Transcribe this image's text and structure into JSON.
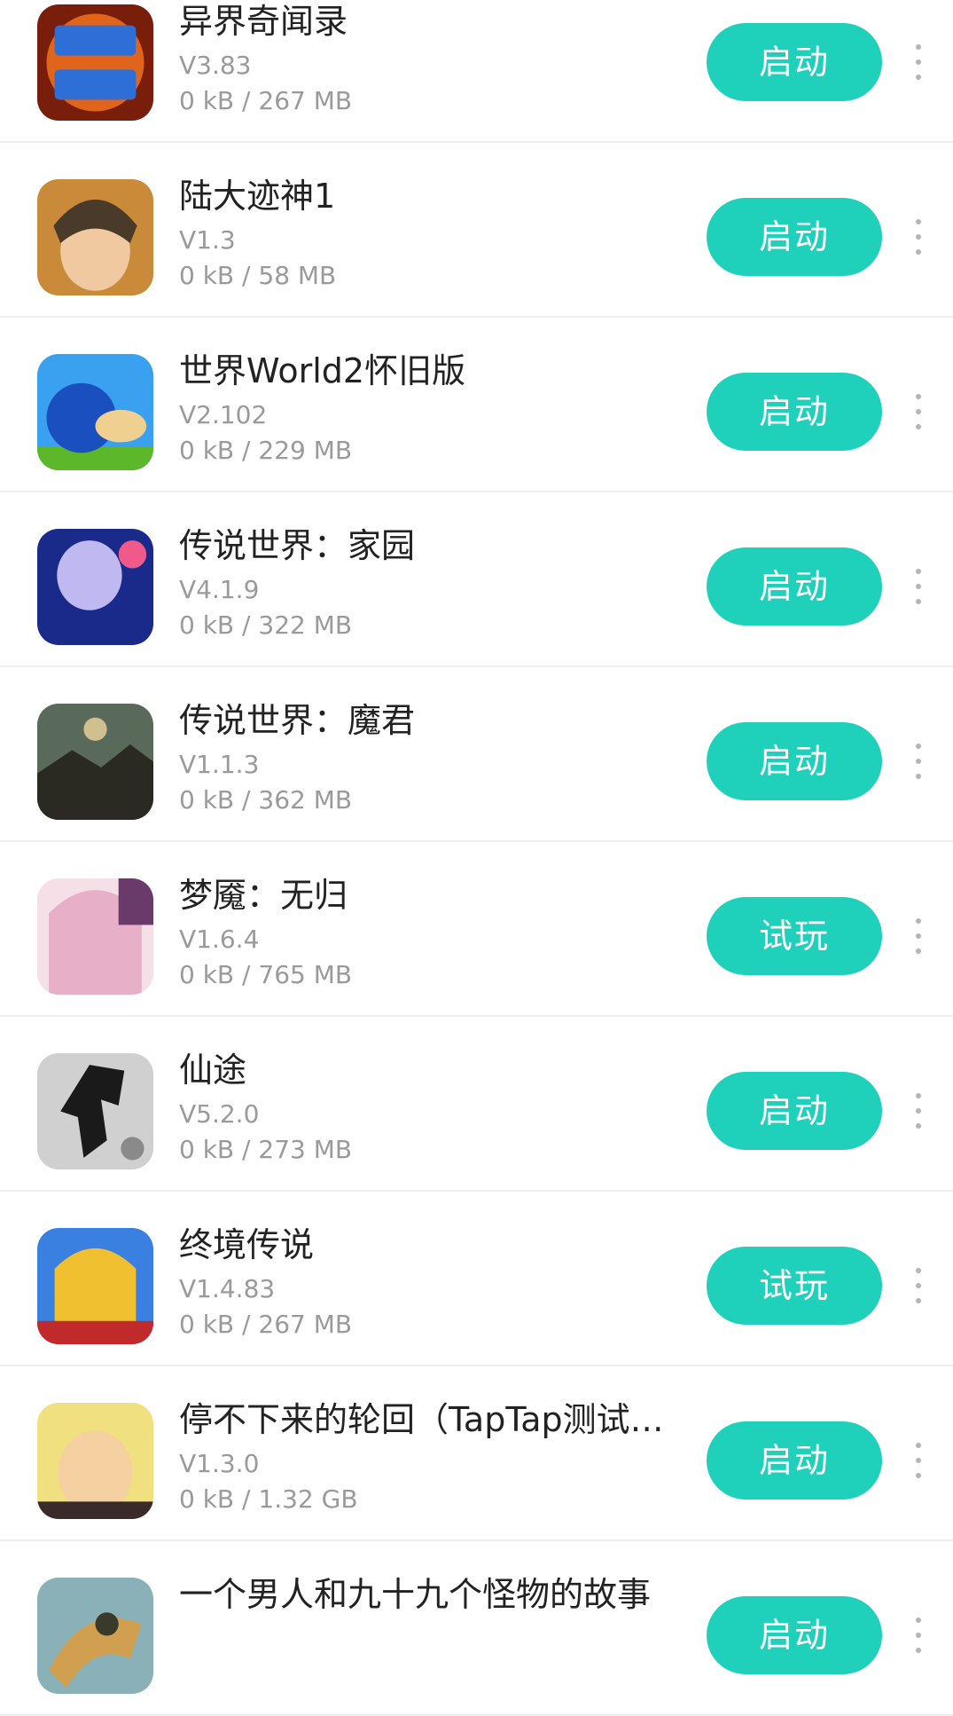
{
  "games": [
    {
      "title": "异界奇闻录",
      "version": "V3.83",
      "size": "0 kB / 267 MB",
      "action": "启动",
      "icon": "yijie-qiwenlu-icon",
      "icon_colors": [
        "#7a1e0c",
        "#e0641a",
        "#2d6fd6"
      ]
    },
    {
      "title": "陆大迹神1",
      "version": "V1.3",
      "size": "0 kB / 58 MB",
      "action": "启动",
      "icon": "luda-jishen-icon",
      "icon_colors": [
        "#c98a3a",
        "#4a3a2a",
        "#f0c9a0"
      ]
    },
    {
      "title": "世界World2怀旧版",
      "version": "V2.102",
      "size": "0 kB / 229 MB",
      "action": "启动",
      "icon": "snail-icon",
      "icon_colors": [
        "#3aa0f0",
        "#1a4fc0",
        "#f0d090"
      ]
    },
    {
      "title": "传说世界：家园",
      "version": "V4.1.9",
      "size": "0 kB / 322 MB",
      "action": "启动",
      "icon": "legend-home-icon",
      "icon_colors": [
        "#1a2a8a",
        "#c0b8f0",
        "#f05a8a"
      ]
    },
    {
      "title": "传说世界：魔君",
      "version": "V1.1.3",
      "size": "0 kB / 362 MB",
      "action": "启动",
      "icon": "legend-demon-icon",
      "icon_colors": [
        "#5a6a5a",
        "#2a2a22",
        "#d0c090"
      ]
    },
    {
      "title": "梦魇：无归",
      "version": "V1.6.4",
      "size": "0 kB / 765 MB",
      "action": "试玩",
      "icon": "nightmare-icon",
      "icon_colors": [
        "#e8b0c8",
        "#6a3a6a",
        "#f5e0e8"
      ]
    },
    {
      "title": "仙途",
      "version": "V5.2.0",
      "size": "0 kB / 273 MB",
      "action": "启动",
      "icon": "xiantu-icon",
      "icon_colors": [
        "#d0d0d0",
        "#1a1a1a",
        "#8a8a8a"
      ]
    },
    {
      "title": "终境传说",
      "version": "V1.4.83",
      "size": "0 kB / 267 MB",
      "action": "试玩",
      "icon": "zhongjing-icon",
      "icon_colors": [
        "#3a80e0",
        "#f0c030",
        "#c02a2a"
      ]
    },
    {
      "title": "停不下来的轮回（TapTap测试…",
      "version": "V1.3.0",
      "size": "0 kB / 1.32 GB",
      "action": "启动",
      "icon": "samsara-icon",
      "icon_colors": [
        "#f0e080",
        "#f5d0a0",
        "#3a2a2a"
      ]
    },
    {
      "title": "一个男人和九十九个怪物的故事",
      "version": "",
      "size": "",
      "action": "启动",
      "icon": "monster-story-icon",
      "icon_colors": [
        "#8ab0b8",
        "#d0a050",
        "#3a3a2a"
      ]
    }
  ],
  "more_icon": "more-vertical-icon",
  "accent_color": "#1fd1bb"
}
